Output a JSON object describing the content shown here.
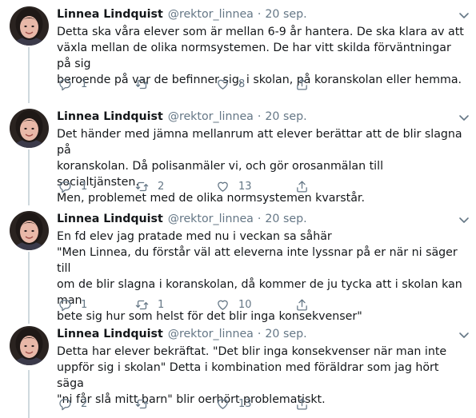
{
  "tweets": [
    {
      "name": "Linnea Lindquist",
      "handle": "@rektor_linnea",
      "separator": "·",
      "date": "20 sep.",
      "text": "Detta ska våra elever som är mellan 6-9 år hantera. De ska klara av att\nväxla mellan de olika normsystemen. De har vitt skilda förväntningar på sig\nberoende på var de befinner sig, i skolan, på koranskolan eller hemma.",
      "replies": "1",
      "retweets": "",
      "likes": "8"
    },
    {
      "name": "Linnea Lindquist",
      "handle": "@rektor_linnea",
      "separator": "·",
      "date": "20 sep.",
      "text": "Det händer med jämna mellanrum att elever berättar att de blir slagna på\nkoranskolan. Då polisanmäler vi, och gör orosanmälan till socialtjänsten.\nMen, problemet med de olika normsystemen kvarstår.",
      "replies": "1",
      "retweets": "2",
      "likes": "13"
    },
    {
      "name": "Linnea Lindquist",
      "handle": "@rektor_linnea",
      "separator": "·",
      "date": "20 sep.",
      "text": "En fd elev jag pratade med nu i veckan sa såhär\n\"Men Linnea, du förstår väl att eleverna inte lyssnar på er när ni säger till\nom de blir slagna i koranskolan, då kommer de ju tycka att i skolan kan man\nbete sig hur som helst för det blir inga konsekvenser\"",
      "replies": "1",
      "retweets": "1",
      "likes": "10"
    },
    {
      "name": "Linnea Lindquist",
      "handle": "@rektor_linnea",
      "separator": "·",
      "date": "20 sep.",
      "text": "Detta har elever bekräftat. \"Det blir inga konsekvenser när man inte\nuppför sig i skolan\" Detta i kombination med föräldrar som jag hört säga\n\"ni får slå mitt barn\" blir oerhört problematiskt.",
      "replies": "2",
      "retweets": "",
      "likes": "13"
    }
  ],
  "icons": {
    "reply": "reply-icon",
    "retweet": "retweet-icon",
    "like": "heart-icon",
    "share": "share-icon",
    "more": "chevron-down-icon"
  },
  "colors": {
    "text": "#14171a",
    "muted": "#657786",
    "thread_line": "#cfd9de"
  }
}
